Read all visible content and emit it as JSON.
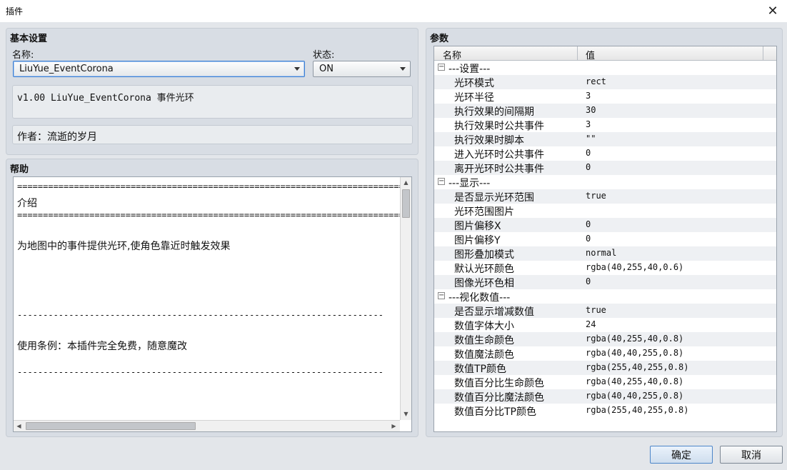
{
  "window": {
    "title": "插件"
  },
  "basic": {
    "title": "基本设置",
    "name_label": "名称:",
    "name_value": "LiuYue_EventCorona",
    "status_label": "状态:",
    "status_value": "ON",
    "description": "v1.00 LiuYue_EventCorona 事件光环",
    "author": "作者：流逝的岁月"
  },
  "help": {
    "title": "帮助",
    "lines": [
      "=============================================================================",
      "介绍",
      "============================================================================= *",
      "",
      "为地图中的事件提供光环,使角色靠近时触发效果",
      "",
      "",
      "",
      "",
      "-----------------------------------------------------------------------",
      "",
      "使用条例：本插件完全免费，随意魔改",
      "",
      "-----------------------------------------------------------------------"
    ]
  },
  "params": {
    "title": "参数",
    "col_name": "名称",
    "col_value": "值",
    "rows": [
      {
        "name": "---设置---",
        "value": "",
        "category": true
      },
      {
        "name": "光环模式",
        "value": "rect"
      },
      {
        "name": "光环半径",
        "value": "3"
      },
      {
        "name": "执行效果的间隔期",
        "value": "30"
      },
      {
        "name": "执行效果时公共事件",
        "value": "3"
      },
      {
        "name": "执行效果时脚本",
        "value": "\"\""
      },
      {
        "name": "进入光环时公共事件",
        "value": "0"
      },
      {
        "name": "离开光环时公共事件",
        "value": "0"
      },
      {
        "name": "---显示---",
        "value": "",
        "category": true
      },
      {
        "name": "是否显示光环范围",
        "value": "true"
      },
      {
        "name": "光环范围图片",
        "value": ""
      },
      {
        "name": "图片偏移X",
        "value": "0"
      },
      {
        "name": "图片偏移Y",
        "value": "0"
      },
      {
        "name": "图形叠加模式",
        "value": "normal"
      },
      {
        "name": "默认光环颜色",
        "value": "rgba(40,255,40,0.6)"
      },
      {
        "name": "图像光环色相",
        "value": "0"
      },
      {
        "name": "---视化数值---",
        "value": "",
        "category": true
      },
      {
        "name": "是否显示增减数值",
        "value": "true"
      },
      {
        "name": "数值字体大小",
        "value": "24"
      },
      {
        "name": "数值生命颜色",
        "value": "rgba(40,255,40,0.8)"
      },
      {
        "name": "数值魔法颜色",
        "value": "rgba(40,40,255,0.8)"
      },
      {
        "name": "数值TP颜色",
        "value": "rgba(255,40,255,0.8)"
      },
      {
        "name": "数值百分比生命颜色",
        "value": "rgba(40,255,40,0.8)"
      },
      {
        "name": "数值百分比魔法颜色",
        "value": "rgba(40,40,255,0.8)"
      },
      {
        "name": "数值百分比TP颜色",
        "value": "rgba(255,40,255,0.8)"
      }
    ]
  },
  "buttons": {
    "ok": "确定",
    "cancel": "取消"
  }
}
